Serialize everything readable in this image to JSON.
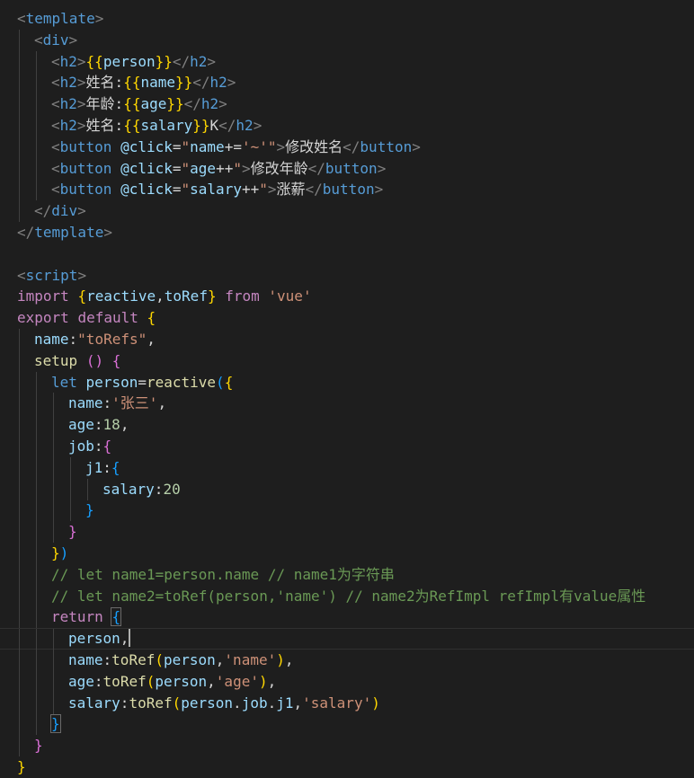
{
  "editor": {
    "lines": [
      [
        [
          "tag",
          "<"
        ],
        [
          "tn",
          "template"
        ],
        [
          "tag",
          ">"
        ]
      ],
      [
        [
          "tag",
          "<"
        ],
        [
          "tn",
          "div"
        ],
        [
          "tag",
          ">"
        ]
      ],
      [
        [
          "tag",
          "<"
        ],
        [
          "tn",
          "h2"
        ],
        [
          "tag",
          ">"
        ],
        [
          "b1",
          "{{"
        ],
        [
          "var",
          "person"
        ],
        [
          "b1",
          "}}"
        ],
        [
          "tag",
          "</"
        ],
        [
          "tn",
          "h2"
        ],
        [
          "tag",
          ">"
        ]
      ],
      [
        [
          "tag",
          "<"
        ],
        [
          "tn",
          "h2"
        ],
        [
          "tag",
          ">"
        ],
        [
          "txt",
          "姓名:"
        ],
        [
          "b1",
          "{{"
        ],
        [
          "var",
          "name"
        ],
        [
          "b1",
          "}}"
        ],
        [
          "tag",
          "</"
        ],
        [
          "tn",
          "h2"
        ],
        [
          "tag",
          ">"
        ]
      ],
      [
        [
          "tag",
          "<"
        ],
        [
          "tn",
          "h2"
        ],
        [
          "tag",
          ">"
        ],
        [
          "txt",
          "年龄:"
        ],
        [
          "b1",
          "{{"
        ],
        [
          "var",
          "age"
        ],
        [
          "b1",
          "}}"
        ],
        [
          "tag",
          "</"
        ],
        [
          "tn",
          "h2"
        ],
        [
          "tag",
          ">"
        ]
      ],
      [
        [
          "tag",
          "<"
        ],
        [
          "tn",
          "h2"
        ],
        [
          "tag",
          ">"
        ],
        [
          "txt",
          "姓名:"
        ],
        [
          "b1",
          "{{"
        ],
        [
          "var",
          "salary"
        ],
        [
          "b1",
          "}}"
        ],
        [
          "txt",
          "K"
        ],
        [
          "tag",
          "</"
        ],
        [
          "tn",
          "h2"
        ],
        [
          "tag",
          ">"
        ]
      ],
      [
        [
          "tag",
          "<"
        ],
        [
          "tn",
          "button"
        ],
        [
          "txt",
          " "
        ],
        [
          "attr",
          "@click"
        ],
        [
          "txt",
          "="
        ],
        [
          "str",
          "\""
        ],
        [
          "var",
          "name"
        ],
        [
          "txt",
          "+="
        ],
        [
          "str",
          "'~'"
        ],
        [
          "str",
          "\""
        ],
        [
          "tag",
          ">"
        ],
        [
          "txt",
          "修改姓名"
        ],
        [
          "tag",
          "</"
        ],
        [
          "tn",
          "button"
        ],
        [
          "tag",
          ">"
        ]
      ],
      [
        [
          "tag",
          "<"
        ],
        [
          "tn",
          "button"
        ],
        [
          "txt",
          " "
        ],
        [
          "attr",
          "@click"
        ],
        [
          "txt",
          "="
        ],
        [
          "str",
          "\""
        ],
        [
          "var",
          "age"
        ],
        [
          "txt",
          "++"
        ],
        [
          "str",
          "\""
        ],
        [
          "tag",
          ">"
        ],
        [
          "txt",
          "修改年龄"
        ],
        [
          "tag",
          "</"
        ],
        [
          "tn",
          "button"
        ],
        [
          "tag",
          ">"
        ]
      ],
      [
        [
          "tag",
          "<"
        ],
        [
          "tn",
          "button"
        ],
        [
          "txt",
          " "
        ],
        [
          "attr",
          "@click"
        ],
        [
          "txt",
          "="
        ],
        [
          "str",
          "\""
        ],
        [
          "var",
          "salary"
        ],
        [
          "txt",
          "++"
        ],
        [
          "str",
          "\""
        ],
        [
          "tag",
          ">"
        ],
        [
          "txt",
          "涨薪"
        ],
        [
          "tag",
          "</"
        ],
        [
          "tn",
          "button"
        ],
        [
          "tag",
          ">"
        ]
      ],
      [
        [
          "tag",
          "</"
        ],
        [
          "tn",
          "div"
        ],
        [
          "tag",
          ">"
        ]
      ],
      [
        [
          "tag",
          "</"
        ],
        [
          "tn",
          "template"
        ],
        [
          "tag",
          ">"
        ]
      ],
      [],
      [
        [
          "tag",
          "<"
        ],
        [
          "tn",
          "script"
        ],
        [
          "tag",
          ">"
        ]
      ],
      [
        [
          "kw",
          "import"
        ],
        [
          "txt",
          " "
        ],
        [
          "b1",
          "{"
        ],
        [
          "var",
          "reactive"
        ],
        [
          "txt",
          ","
        ],
        [
          "var",
          "toRef"
        ],
        [
          "b1",
          "}"
        ],
        [
          "txt",
          " "
        ],
        [
          "kw",
          "from"
        ],
        [
          "txt",
          " "
        ],
        [
          "str",
          "'vue'"
        ]
      ],
      [
        [
          "kw",
          "export"
        ],
        [
          "txt",
          " "
        ],
        [
          "kw",
          "default"
        ],
        [
          "txt",
          " "
        ],
        [
          "b1",
          "{"
        ]
      ],
      [
        [
          "var",
          "name"
        ],
        [
          "txt",
          ":"
        ],
        [
          "str",
          "\"toRefs\""
        ],
        [
          "txt",
          ","
        ]
      ],
      [
        [
          "fn",
          "setup"
        ],
        [
          "txt",
          " "
        ],
        [
          "b2",
          "()"
        ],
        [
          "txt",
          " "
        ],
        [
          "b2",
          "{"
        ]
      ],
      [
        [
          "dkw",
          "let"
        ],
        [
          "txt",
          " "
        ],
        [
          "var",
          "person"
        ],
        [
          "txt",
          "="
        ],
        [
          "fn",
          "reactive"
        ],
        [
          "b3",
          "("
        ],
        [
          "b1",
          "{"
        ]
      ],
      [
        [
          "var",
          "name"
        ],
        [
          "txt",
          ":"
        ],
        [
          "str",
          "'张三'"
        ],
        [
          "txt",
          ","
        ]
      ],
      [
        [
          "var",
          "age"
        ],
        [
          "txt",
          ":"
        ],
        [
          "num",
          "18"
        ],
        [
          "txt",
          ","
        ]
      ],
      [
        [
          "var",
          "job"
        ],
        [
          "txt",
          ":"
        ],
        [
          "b2",
          "{"
        ]
      ],
      [
        [
          "var",
          "j1"
        ],
        [
          "txt",
          ":"
        ],
        [
          "b3",
          "{"
        ]
      ],
      [
        [
          "var",
          "salary"
        ],
        [
          "txt",
          ":"
        ],
        [
          "num",
          "20"
        ]
      ],
      [
        [
          "b3",
          "}"
        ]
      ],
      [
        [
          "b2",
          "}"
        ]
      ],
      [
        [
          "b1",
          "}"
        ],
        [
          "b3",
          ")"
        ]
      ],
      [
        [
          "com",
          "// let name1=person.name // name1为字符串"
        ]
      ],
      [
        [
          "com",
          "// let name2=toRef(person,'name') // name2为RefImpl refImpl有value属性"
        ]
      ],
      [
        [
          "kw",
          "return"
        ],
        [
          "txt",
          " "
        ],
        [
          "b3",
          "{"
        ]
      ],
      [
        [
          "var",
          "person"
        ],
        [
          "txt",
          ","
        ]
      ],
      [
        [
          "var",
          "name"
        ],
        [
          "txt",
          ":"
        ],
        [
          "fn",
          "toRef"
        ],
        [
          "b1",
          "("
        ],
        [
          "var",
          "person"
        ],
        [
          "txt",
          ","
        ],
        [
          "str",
          "'name'"
        ],
        [
          "b1",
          ")"
        ],
        [
          "txt",
          ","
        ]
      ],
      [
        [
          "var",
          "age"
        ],
        [
          "txt",
          ":"
        ],
        [
          "fn",
          "toRef"
        ],
        [
          "b1",
          "("
        ],
        [
          "var",
          "person"
        ],
        [
          "txt",
          ","
        ],
        [
          "str",
          "'age'"
        ],
        [
          "b1",
          ")"
        ],
        [
          "txt",
          ","
        ]
      ],
      [
        [
          "var",
          "salary"
        ],
        [
          "txt",
          ":"
        ],
        [
          "fn",
          "toRef"
        ],
        [
          "b1",
          "("
        ],
        [
          "var",
          "person"
        ],
        [
          "txt",
          "."
        ],
        [
          "var",
          "job"
        ],
        [
          "txt",
          "."
        ],
        [
          "var",
          "j1"
        ],
        [
          "txt",
          ","
        ],
        [
          "str",
          "'salary'"
        ],
        [
          "b1",
          ")"
        ]
      ],
      [
        [
          "b3",
          "}"
        ]
      ],
      [
        [
          "b2",
          "}"
        ]
      ],
      [
        [
          "b1",
          "}"
        ]
      ]
    ]
  }
}
